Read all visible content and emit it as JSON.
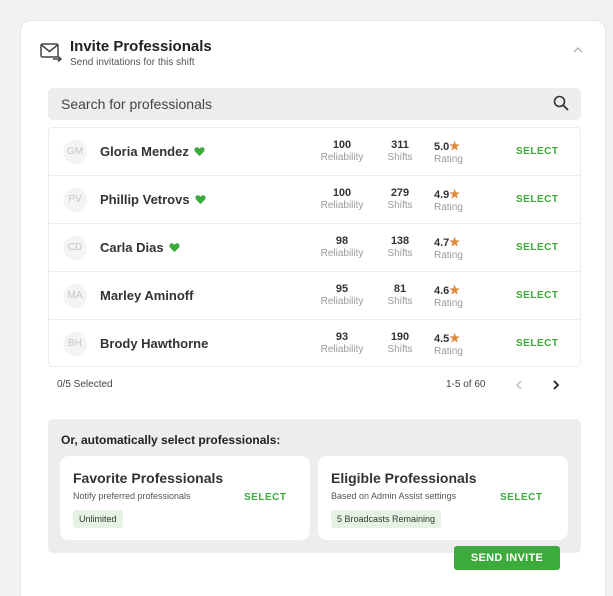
{
  "header": {
    "title": "Invite Professionals",
    "subtitle": "Send invitations for this shift",
    "icon": "mail-send-icon"
  },
  "search": {
    "placeholder": "Search for professionals",
    "icon": "search-icon"
  },
  "professionals": [
    {
      "initials": "GM",
      "name": "Gloria Mendez",
      "favorite": true,
      "reliability": "100",
      "shifts": "311",
      "rating": "5.0",
      "select_label": "SELECT"
    },
    {
      "initials": "PV",
      "name": "Phillip Vetrovs",
      "favorite": true,
      "reliability": "100",
      "shifts": "279",
      "rating": "4.9",
      "select_label": "SELECT"
    },
    {
      "initials": "CD",
      "name": "Carla Dias",
      "favorite": true,
      "reliability": "98",
      "shifts": "138",
      "rating": "4.7",
      "select_label": "SELECT"
    },
    {
      "initials": "MA",
      "name": "Marley Aminoff",
      "favorite": false,
      "reliability": "95",
      "shifts": "81",
      "rating": "4.6",
      "select_label": "SELECT"
    },
    {
      "initials": "BH",
      "name": "Brody Hawthorne",
      "favorite": false,
      "reliability": "93",
      "shifts": "190",
      "rating": "4.5",
      "select_label": "SELECT"
    }
  ],
  "stat_labels": {
    "reliability": "Reliability",
    "shifts": "Shifts",
    "rating": "Rating"
  },
  "pagination": {
    "selected": "0/5 Selected",
    "range": "1-5 of 60"
  },
  "auto": {
    "title": "Or, automatically select professionals:",
    "options": [
      {
        "title": "Favorite Professionals",
        "description": "Notify preferred professionals",
        "select_label": "SELECT",
        "badge": "Unlimited"
      },
      {
        "title": "Eligible Professionals",
        "description": "Based on Admin Assist settings",
        "select_label": "SELECT",
        "badge": "5 Broadcasts Remaining"
      }
    ]
  },
  "send_label": "SEND INVITE",
  "colors": {
    "accent": "#3cab3c",
    "star": "#e08a3c",
    "badge_bg": "#e6f3e4"
  }
}
